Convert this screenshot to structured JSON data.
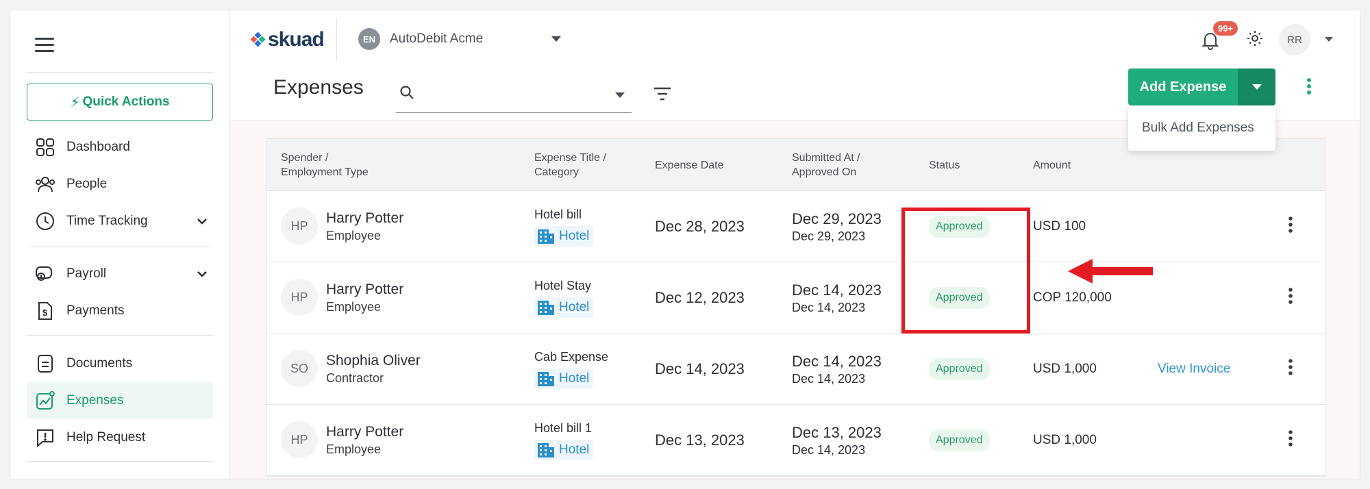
{
  "sidebar": {
    "quick_actions": "Quick Actions",
    "items": [
      {
        "label": "Dashboard",
        "icon": "grid-icon"
      },
      {
        "label": "People",
        "icon": "people-icon"
      },
      {
        "label": "Time Tracking",
        "icon": "clock-icon"
      },
      {
        "label": "Payroll",
        "icon": "payroll-icon"
      },
      {
        "label": "Payments",
        "icon": "payments-icon"
      },
      {
        "label": "Documents",
        "icon": "document-icon"
      },
      {
        "label": "Expenses",
        "icon": "expenses-icon",
        "active": true
      },
      {
        "label": "Help Request",
        "icon": "help-icon"
      }
    ]
  },
  "topbar": {
    "logo": "skuad",
    "company_initials": "EN",
    "company_name": "AutoDebit Acme",
    "notification_count": "99+",
    "user_initials": "RR"
  },
  "header": {
    "title": "Expenses",
    "search_placeholder": "",
    "add_button": "Add Expense",
    "bulk_add": "Bulk Add Expenses"
  },
  "table": {
    "columns": {
      "spender": "Spender /",
      "spender2": "Employment Type",
      "title": "Expense Title /",
      "title2": "Category",
      "date": "Expense Date",
      "submitted": "Submitted At /",
      "submitted2": "Approved On",
      "status": "Status",
      "amount": "Amount"
    },
    "rows": [
      {
        "initials": "HP",
        "name": "Harry Potter",
        "type": "Employee",
        "title": "Hotel bill",
        "category": "Hotel",
        "date": "Dec 28, 2023",
        "submitted": "Dec 29, 2023",
        "approved": "Dec 29, 2023",
        "status": "Approved",
        "amount": "USD 100",
        "link": ""
      },
      {
        "initials": "HP",
        "name": "Harry Potter",
        "type": "Employee",
        "title": "Hotel Stay",
        "category": "Hotel",
        "date": "Dec 12, 2023",
        "submitted": "Dec 14, 2023",
        "approved": "Dec 14, 2023",
        "status": "Approved",
        "amount": "COP 120,000",
        "link": ""
      },
      {
        "initials": "SO",
        "name": "Shophia Oliver",
        "type": "Contractor",
        "title": "Cab Expense",
        "category": "Hotel",
        "date": "Dec 14, 2023",
        "submitted": "Dec 14, 2023",
        "approved": "Dec 14, 2023",
        "status": "Approved",
        "amount": "USD 1,000",
        "link": "View Invoice"
      },
      {
        "initials": "HP",
        "name": "Harry Potter",
        "type": "Employee",
        "title": "Hotel bill 1",
        "category": "Hotel",
        "date": "Dec 13, 2023",
        "submitted": "Dec 13, 2023",
        "approved": "Dec 14, 2023",
        "status": "Approved",
        "amount": "USD 1,000",
        "link": ""
      }
    ]
  },
  "colors": {
    "brand_green": "#20ad7c",
    "status_green": "#2a9a5e",
    "link_blue": "#2f95cf",
    "annotation_red": "#e31b23"
  }
}
